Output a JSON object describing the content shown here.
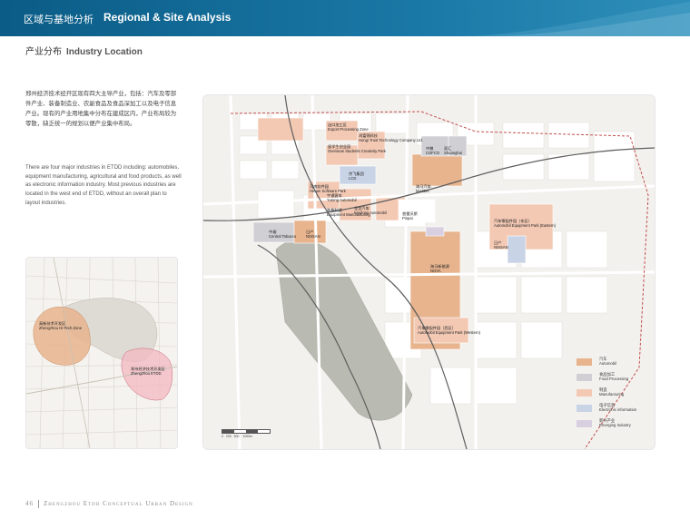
{
  "header": {
    "title_cn": "区域与基地分析",
    "title_en": "Regional & Site Analysis"
  },
  "section": {
    "title_cn": "产业分布",
    "title_en": "Industry Location"
  },
  "body": {
    "paragraph_cn": "郑州经济技术经开区现有四大主导产业，包括：汽车及零部件产业、装备制造业、农副食品及食品深加工以及电子信息产业。现有的产业用地集中分布在建成区内，产业布局较为零散，缺乏统一的规划以便产业集中布局。",
    "paragraph_en": "There are four major industries in ETDD including: automobiles, equipment manufacturing, agricultural and food products, as well as electronic information industry. Most previous industries are located in the west end of ETDD, without an overall plan to layout industries."
  },
  "small_map": {
    "labels": [
      {
        "cn": "高新技术开发区",
        "en": "Zhengzhou Hi-Tech Zone"
      },
      {
        "cn": "郑州经济技术开发区",
        "en": "Zhengzhou ETDD"
      }
    ]
  },
  "big_map": {
    "labels": [
      {
        "id": "export",
        "cn": "出口加工区",
        "en": "Export Processing Zone"
      },
      {
        "id": "hongtu",
        "cn": "鸿富锦科技",
        "en": "Hongi Trust Technology Company Ltd."
      },
      {
        "id": "overseas",
        "cn": "留学生创业园",
        "en": "Overseas Students Creativity Park"
      },
      {
        "id": "cofco_cn",
        "cn": "中粮",
        "en": "COFCO"
      },
      {
        "id": "shuanghui_cn",
        "cn": "双汇",
        "en": "Shuanghui"
      },
      {
        "id": "lcd",
        "cn": "京飞集团",
        "en": "LCD"
      },
      {
        "id": "software",
        "cn": "河南软件园",
        "en": "Henan Software Park"
      },
      {
        "id": "yutong",
        "cn": "宇通客车",
        "en": "Yutong Automobil"
      },
      {
        "id": "equip",
        "cn": "装备制造",
        "en": "Equipment Manufacturing"
      },
      {
        "id": "kinglong",
        "cn": "金龙汽车",
        "en": "Kinglong Automobil"
      },
      {
        "id": "mazda",
        "cn": "海马汽车",
        "en": "MAZDA"
      },
      {
        "id": "pinpai",
        "cn": "普雷沃斯",
        "en": "Pinpai"
      },
      {
        "id": "tobacco",
        "cn": "中烟",
        "en": "Central Tobacco"
      },
      {
        "id": "nissan1",
        "cn": "日产",
        "en": "NISSAN"
      },
      {
        "id": "nissan2",
        "cn": "日产",
        "en": "NISSAN"
      },
      {
        "id": "eastern",
        "cn": "汽车零配件园（东区）",
        "en": "Automobil Equipment Park (Eastern)"
      },
      {
        "id": "nova",
        "cn": "海马新能源",
        "en": "NOVA"
      },
      {
        "id": "western",
        "cn": "汽车零配件园（西区）",
        "en": "Automobil Equipment Park (Western)"
      }
    ],
    "legend": [
      {
        "cn": "汽车",
        "en": "Automobil",
        "color": "#e7b48e"
      },
      {
        "cn": "食品加工",
        "en": "Food Processing",
        "color": "#cfcfd4"
      },
      {
        "cn": "制造",
        "en": "Manufacturing",
        "color": "#f3c9b4"
      },
      {
        "cn": "电子信息",
        "en": "Electronic information",
        "color": "#c9d3e6"
      },
      {
        "cn": "新兴产业",
        "en": "Emerging Industry",
        "color": "#d8cfe0"
      }
    ],
    "scale": [
      "0",
      "200",
      "500",
      "1000m"
    ]
  },
  "footer": {
    "page": "46",
    "title": "Zhengzhou Etdd Conceptual Urban Design"
  }
}
